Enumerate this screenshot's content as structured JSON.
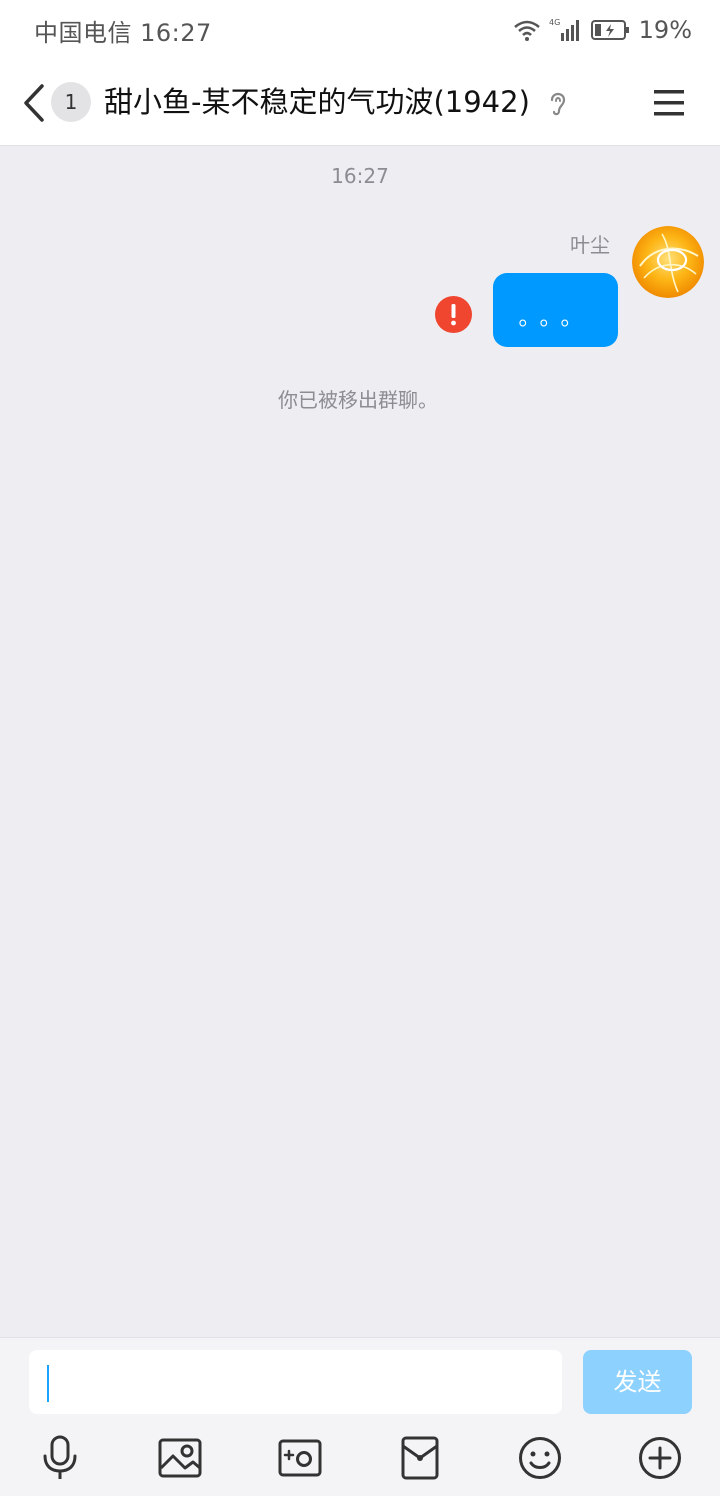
{
  "status_bar": {
    "carrier_time": "中国电信 16:27",
    "network": "4G",
    "battery": "19%"
  },
  "header": {
    "unread_count": "1",
    "title": "甜小鱼-某不稳定的气功波(1942)"
  },
  "chat": {
    "timestamp": "16:27",
    "messages": [
      {
        "sender": "叶尘",
        "text": "。。。",
        "status": "failed"
      }
    ],
    "system_notice": "你已被移出群聊。"
  },
  "input": {
    "value": "",
    "send_label": "发送"
  },
  "toolbar_icons": [
    "microphone-icon",
    "image-icon",
    "camera-icon",
    "red-packet-icon",
    "emoji-icon",
    "plus-icon"
  ],
  "colors": {
    "accent": "#0099ff",
    "send_disabled": "#8dd1ff",
    "error": "#f0452f",
    "background": "#ededf2"
  }
}
